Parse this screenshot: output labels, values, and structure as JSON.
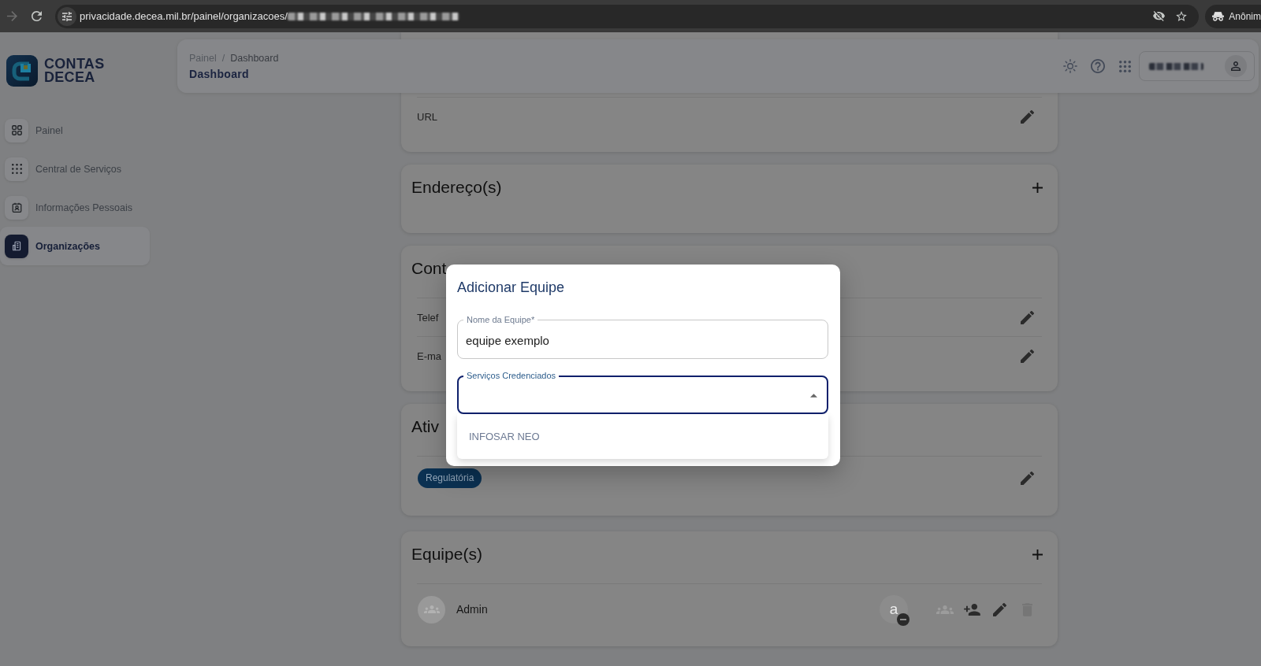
{
  "browser": {
    "url": "privacidade.decea.mil.br/painel/organizacoes/",
    "profile": "Anônim"
  },
  "sidebar": {
    "logo": [
      "CONTAS",
      "DECEA"
    ],
    "items": [
      {
        "label": "Painel",
        "selected": false
      },
      {
        "label": "Central de Serviços",
        "selected": false
      },
      {
        "label": "Informações Pessoais",
        "selected": false
      },
      {
        "label": "Organizações",
        "selected": true
      }
    ]
  },
  "header": {
    "breadcrumb": [
      "Painel",
      "Dashboard"
    ],
    "separator": "/",
    "title": "Dashboard"
  },
  "sections": [
    {
      "kind": "fields",
      "rows": [
        {
          "label": "URL"
        }
      ]
    },
    {
      "kind": "list",
      "title": "Endereço(s)",
      "addable": true
    },
    {
      "kind": "fields",
      "title": "Cont",
      "addable": false,
      "rows": [
        {
          "label": "Telef"
        },
        {
          "label": "E-ma"
        }
      ]
    },
    {
      "kind": "chips",
      "title": "Ativ",
      "addable": false,
      "chips": [
        "Regulatória"
      ]
    },
    {
      "kind": "teams",
      "title": "Equipe(s)",
      "addable": true,
      "teams": [
        {
          "name": "Admin",
          "member_initial": "a",
          "actions": [
            {
              "disabled": true
            },
            {
              "disabled": false
            },
            {
              "disabled": false
            },
            {
              "disabled": true
            }
          ]
        }
      ]
    }
  ],
  "dialog": {
    "title": "Adicionar Equipe",
    "fields": [
      {
        "kind": "text",
        "label": "Nome da Equipe*",
        "value": "equipe exemplo",
        "focused": false
      },
      {
        "kind": "select",
        "label": "Serviços Credenciados",
        "focused": true,
        "expanded": true,
        "options": [
          "INFOSAR NEO"
        ]
      }
    ]
  }
}
